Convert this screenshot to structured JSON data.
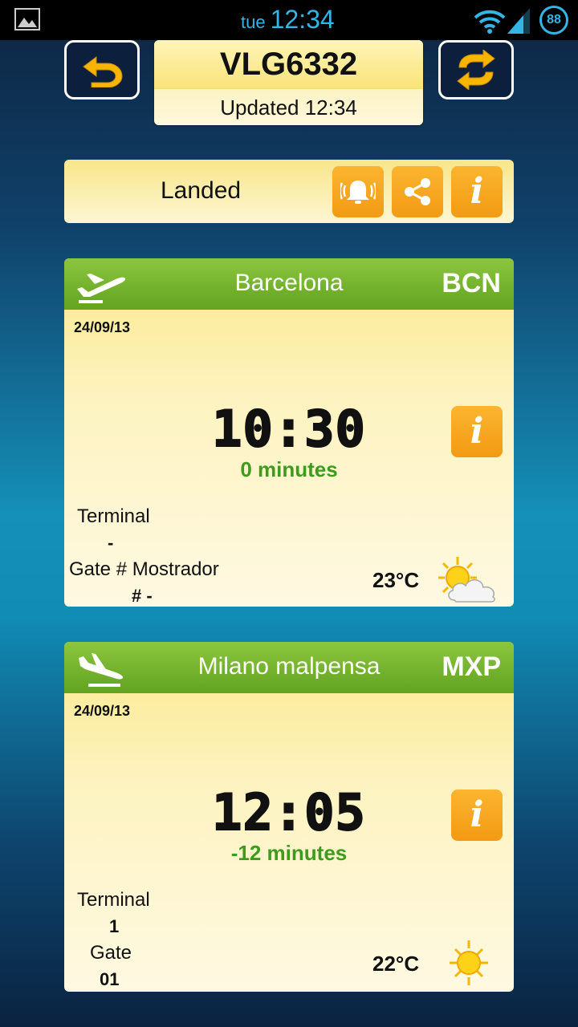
{
  "status_bar": {
    "day": "tue",
    "time": "12:34",
    "battery": "88"
  },
  "header": {
    "flight_number": "VLG6332",
    "updated": "Updated 12:34"
  },
  "status": {
    "text": "Landed"
  },
  "departure": {
    "city": "Barcelona",
    "code": "BCN",
    "date": "24/09/13",
    "time": "10:30",
    "delay": "0 minutes",
    "terminal_label": "Terminal",
    "terminal_value": "-",
    "gate_label": "Gate # Mostrador",
    "gate_value": "#  -",
    "temperature": "23°C",
    "weather_icon": "sun-cloud-icon"
  },
  "arrival": {
    "city": "Milano malpensa",
    "code": "MXP",
    "date": "24/09/13",
    "time": "12:05",
    "delay": "-12 minutes",
    "terminal_label": "Terminal",
    "terminal_value": "1",
    "gate_label": "Gate",
    "gate_value": "01",
    "temperature": "22°C",
    "weather_icon": "sun-icon"
  },
  "colors": {
    "accent_green": "#62a320",
    "accent_orange": "#f39a13",
    "status_blue": "#33b5e5"
  }
}
